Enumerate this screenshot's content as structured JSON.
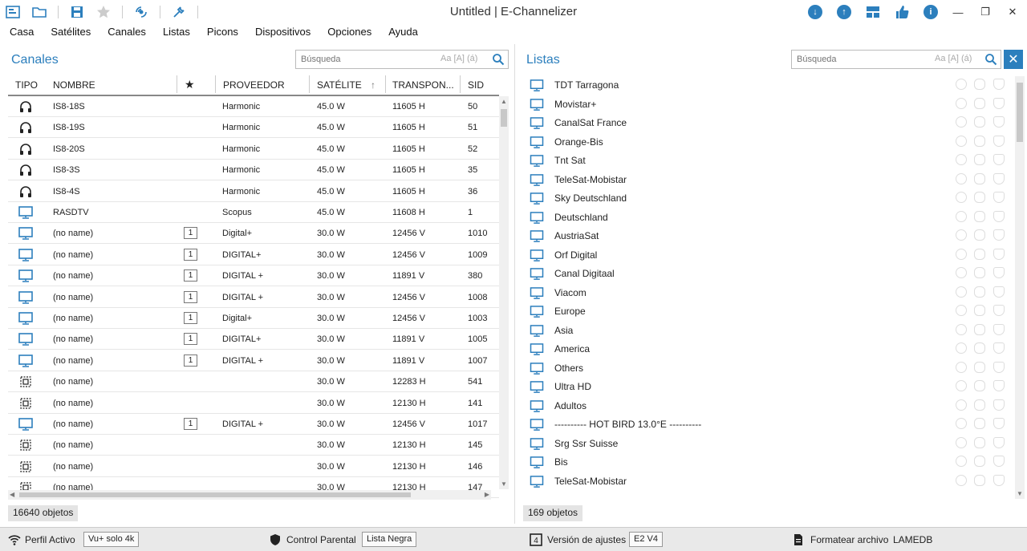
{
  "app": {
    "title": "Untitled | E-Channelizer"
  },
  "menu": [
    "Casa",
    "Satélites",
    "Canales",
    "Listas",
    "Picons",
    "Dispositivos",
    "Opciones",
    "Ayuda"
  ],
  "channels_panel": {
    "title": "Canales",
    "search_placeholder": "Búsqueda",
    "search_options": "Aa [A] (á)",
    "columns": [
      "TIPO",
      "NOMBRE",
      "★",
      "PROVEEDOR",
      "SATÉLITE",
      "TRANSPON...",
      "SID"
    ],
    "sort_column": "SATÉLITE",
    "rows": [
      {
        "type": "radio",
        "name": "IS8-18S",
        "fav": "",
        "provider": "Harmonic",
        "satellite": "45.0 W",
        "transponder": "11605 H",
        "sid": "50"
      },
      {
        "type": "radio",
        "name": "IS8-19S",
        "fav": "",
        "provider": "Harmonic",
        "satellite": "45.0 W",
        "transponder": "11605 H",
        "sid": "51"
      },
      {
        "type": "radio",
        "name": "IS8-20S",
        "fav": "",
        "provider": "Harmonic",
        "satellite": "45.0 W",
        "transponder": "11605 H",
        "sid": "52"
      },
      {
        "type": "radio",
        "name": "IS8-3S",
        "fav": "",
        "provider": "Harmonic",
        "satellite": "45.0 W",
        "transponder": "11605 H",
        "sid": "35"
      },
      {
        "type": "radio",
        "name": "IS8-4S",
        "fav": "",
        "provider": "Harmonic",
        "satellite": "45.0 W",
        "transponder": "11605 H",
        "sid": "36"
      },
      {
        "type": "tv",
        "name": "RASDTV",
        "fav": "",
        "provider": "Scopus",
        "satellite": "45.0 W",
        "transponder": "11608 H",
        "sid": "1"
      },
      {
        "type": "tv",
        "name": "(no name)",
        "fav": "1",
        "provider": "Digital+",
        "satellite": "30.0 W",
        "transponder": "12456 V",
        "sid": "1010"
      },
      {
        "type": "tv",
        "name": "(no name)",
        "fav": "1",
        "provider": "DIGITAL+",
        "satellite": "30.0 W",
        "transponder": "12456 V",
        "sid": "1009"
      },
      {
        "type": "tv",
        "name": "(no name)",
        "fav": "1",
        "provider": "DIGITAL +",
        "satellite": "30.0 W",
        "transponder": "11891 V",
        "sid": "380"
      },
      {
        "type": "tv",
        "name": "(no name)",
        "fav": "1",
        "provider": "DIGITAL +",
        "satellite": "30.0 W",
        "transponder": "12456 V",
        "sid": "1008"
      },
      {
        "type": "tv",
        "name": "(no name)",
        "fav": "1",
        "provider": "Digital+",
        "satellite": "30.0 W",
        "transponder": "12456 V",
        "sid": "1003"
      },
      {
        "type": "tv",
        "name": "(no name)",
        "fav": "1",
        "provider": "DIGITAL+",
        "satellite": "30.0 W",
        "transponder": "11891 V",
        "sid": "1005"
      },
      {
        "type": "tv",
        "name": "(no name)",
        "fav": "1",
        "provider": "DIGITAL +",
        "satellite": "30.0 W",
        "transponder": "11891 V",
        "sid": "1007"
      },
      {
        "type": "data",
        "name": "(no name)",
        "fav": "",
        "provider": "",
        "satellite": "30.0 W",
        "transponder": "12283 H",
        "sid": "541"
      },
      {
        "type": "data",
        "name": "(no name)",
        "fav": "",
        "provider": "",
        "satellite": "30.0 W",
        "transponder": "12130 H",
        "sid": "141"
      },
      {
        "type": "tv",
        "name": "(no name)",
        "fav": "1",
        "provider": "DIGITAL +",
        "satellite": "30.0 W",
        "transponder": "12456 V",
        "sid": "1017"
      },
      {
        "type": "data",
        "name": "(no name)",
        "fav": "",
        "provider": "",
        "satellite": "30.0 W",
        "transponder": "12130 H",
        "sid": "145"
      },
      {
        "type": "data",
        "name": "(no name)",
        "fav": "",
        "provider": "",
        "satellite": "30.0 W",
        "transponder": "12130 H",
        "sid": "146"
      },
      {
        "type": "data",
        "name": "(no name)",
        "fav": "",
        "provider": "",
        "satellite": "30.0 W",
        "transponder": "12130 H",
        "sid": "147"
      }
    ],
    "count_label": "16640 objetos"
  },
  "lists_panel": {
    "title": "Listas",
    "search_placeholder": "Búsqueda",
    "search_options": "Aa [A] (á)",
    "items": [
      "TDT Tarragona",
      "Movistar+",
      "CanalSat France",
      "Orange-Bis",
      "Tnt Sat",
      "TeleSat-Mobistar",
      "Sky Deutschland",
      "Deutschland",
      "AustriaSat",
      "Orf Digital",
      "Canal Digitaal",
      "Viacom",
      "Europe",
      "Asia",
      "America",
      "Others",
      "Ultra HD",
      "Adultos",
      "---------- HOT BIRD 13.0°E ----------",
      "Srg Ssr Suisse",
      "Bis",
      "TeleSat-Mobistar"
    ],
    "count_label": "169 objetos"
  },
  "statusbar": {
    "profile_label": "Perfil Activo",
    "profile_value": "Vu+ solo 4k",
    "parental_label": "Control Parental",
    "parental_value": "Lista Negra",
    "settings_label": "Versión de ajustes",
    "settings_value": "E2 V4",
    "format_label": "Formatear archivo",
    "format_value": "LAMEDB"
  },
  "colors": {
    "accent": "#2c7fbd"
  }
}
